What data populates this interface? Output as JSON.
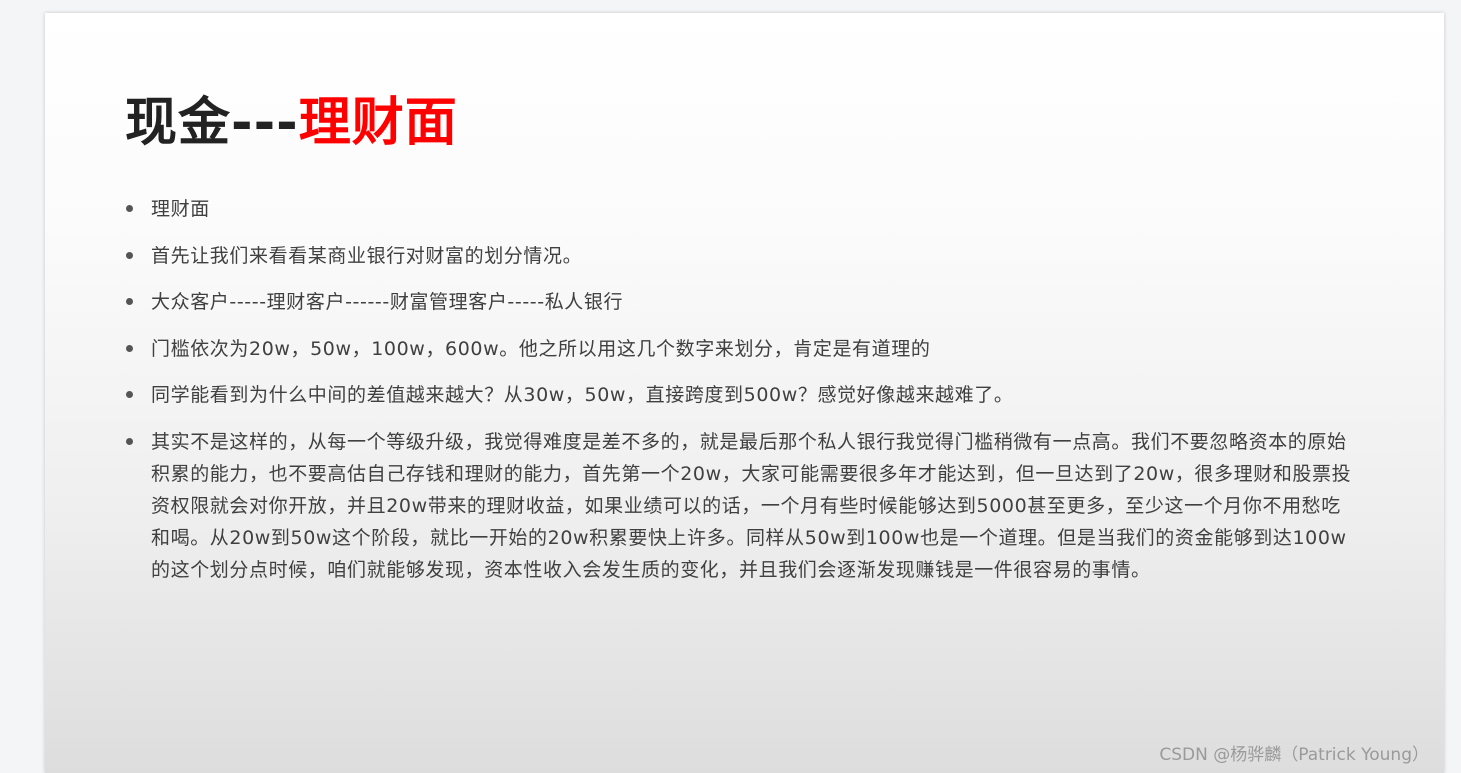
{
  "slide": {
    "title_part1": "现金---",
    "title_part2": "理财面",
    "title_colors": {
      "part1": "#222222",
      "part2": "#ff0000"
    },
    "bullets": [
      "理财面",
      "首先让我们来看看某商业银行对财富的划分情况。",
      "大众客户-----理财客户------财富管理客户-----私人银行",
      "门槛依次为20w，50w，100w，600w。他之所以用这几个数字来划分，肯定是有道理的",
      "同学能看到为什么中间的差值越来越大？从30w，50w，直接跨度到500w？感觉好像越来越难了。",
      "其实不是这样的，从每一个等级升级，我觉得难度是差不多的，就是最后那个私人银行我觉得门槛稍微有一点高。我们不要忽略资本的原始积累的能力，也不要高估自己存钱和理财的能力，首先第一个20w，大家可能需要很多年才能达到，但一旦达到了20w，很多理财和股票投资权限就会对你开放，并且20w带来的理财收益，如果业绩可以的话，一个月有些时候能够达到5000甚至更多，至少这一个月你不用愁吃和喝。从20w到50w这个阶段，就比一开始的20w积累要快上许多。同样从50w到100w也是一个道理。但是当我们的资金能够到达100w的这个划分点时候，咱们就能够发现，资本性收入会发生质的变化，并且我们会逐渐发现赚钱是一件很容易的事情。"
    ]
  },
  "watermark": "CSDN @杨骅麟（Patrick Young）"
}
